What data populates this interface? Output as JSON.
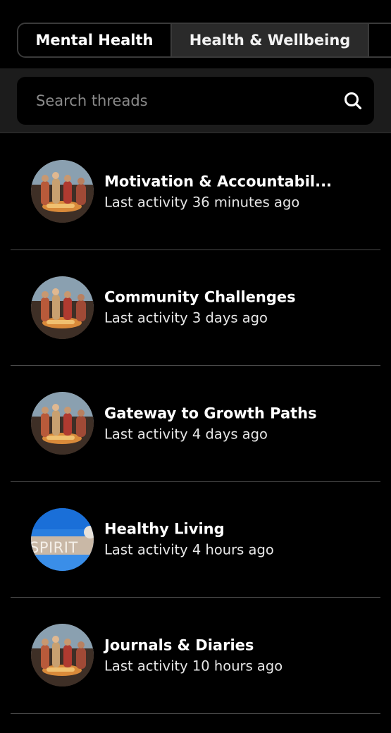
{
  "tabs": [
    {
      "label": "Mental Health"
    },
    {
      "label": "Health & Wellbeing"
    }
  ],
  "search": {
    "placeholder": "Search threads"
  },
  "threads": [
    {
      "title": "Motivation & Accountabil...",
      "activity": "Last activity 36 minutes ago",
      "avatar": "campfire-group-photo"
    },
    {
      "title": "Community Challenges",
      "activity": "Last activity 3 days ago",
      "avatar": "campfire-group-photo"
    },
    {
      "title": "Gateway to Growth Paths",
      "activity": "Last activity 4 days ago",
      "avatar": "campfire-group-photo"
    },
    {
      "title": "Healthy Living",
      "activity": "Last activity 4 hours ago",
      "avatar": "spirit-sign-photo",
      "avatar_text": "SPIRIT"
    },
    {
      "title": "Journals & Diaries",
      "activity": "Last activity 10 hours ago",
      "avatar": "campfire-group-photo"
    }
  ]
}
